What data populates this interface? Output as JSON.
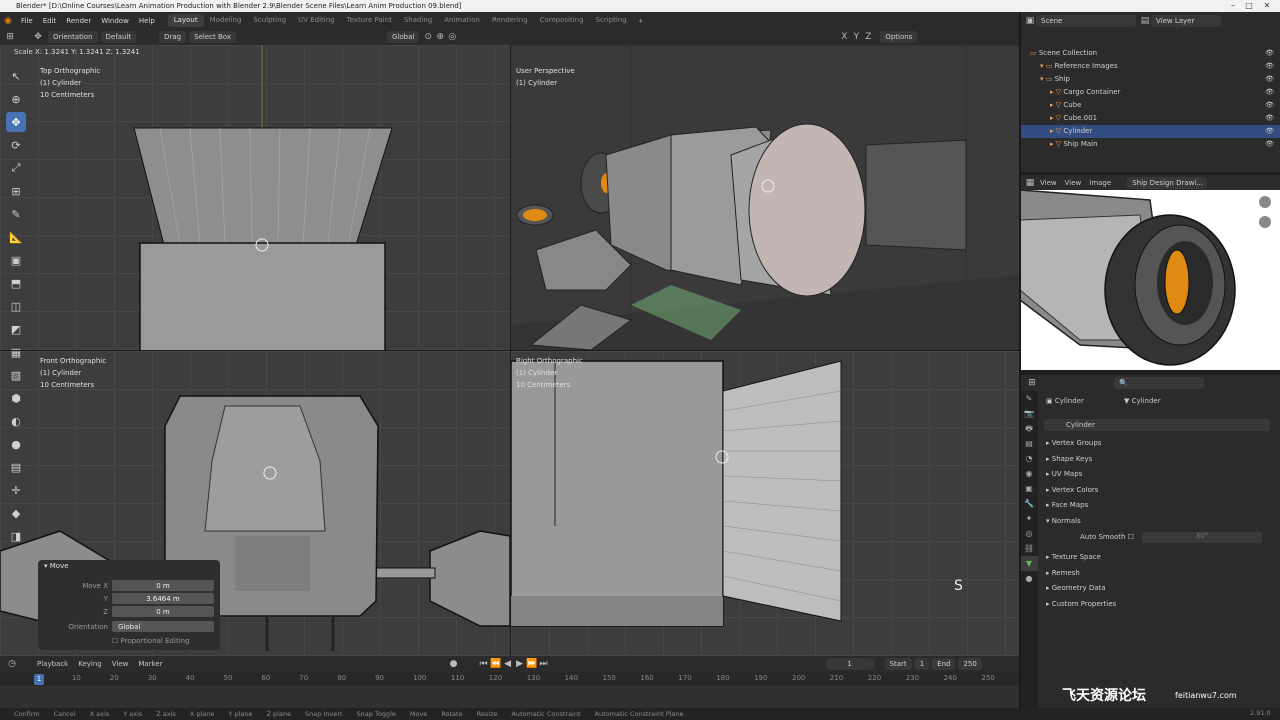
{
  "window": {
    "title": "Blender* [D:\\Online Courses\\Learn Animation Production with Blender 2.9\\Blender Scene Files\\Learn Anim Production 09.blend]"
  },
  "menus": [
    "File",
    "Edit",
    "Render",
    "Window",
    "Help"
  ],
  "workspaces": [
    "Layout",
    "Modeling",
    "Sculpting",
    "UV Editing",
    "Texture Paint",
    "Shading",
    "Animation",
    "Rendering",
    "Compositing",
    "Scripting"
  ],
  "active_workspace": "Layout",
  "scene": {
    "label": "Scene",
    "view_layer": "View Layer"
  },
  "header": {
    "orientation_label": "Orientation",
    "orientation_value": "Default",
    "drag_label": "Drag",
    "drag_value": "Select Box",
    "transform_orientation": "Global",
    "options": "Options",
    "axes": [
      "X",
      "Y",
      "Z"
    ]
  },
  "scale_info": "Scale X: 1.3241   Y: 1.3241   Z: 1.3241",
  "viewports": {
    "top": {
      "name": "Top Orthographic",
      "object": "(1) Cylinder",
      "units": "10 Centimeters"
    },
    "persp": {
      "name": "User Perspective",
      "object": "(1) Cylinder"
    },
    "front": {
      "name": "Front Orthographic",
      "object": "(1) Cylinder",
      "units": "10 Centimeters"
    },
    "right": {
      "name": "Right Orthographic",
      "object": "(1) Cylinder",
      "units": "10 Centimeters"
    }
  },
  "key_overlay": "S",
  "redo_panel": {
    "title": "Move",
    "move_x_label": "Move X",
    "move_x": "0 m",
    "y_label": "Y",
    "move_y": "3.6464 m",
    "z_label": "Z",
    "move_z": "0 m",
    "orientation_label": "Orientation",
    "orientation_value": "Global",
    "proportional": "Proportional Editing"
  },
  "timeline": {
    "menus": [
      "Playback",
      "Keying",
      "View",
      "Marker"
    ],
    "current_frame": "1",
    "start_label": "Start",
    "start": "1",
    "end_label": "End",
    "end": "250",
    "ticks": [
      "1",
      "10",
      "20",
      "30",
      "40",
      "50",
      "60",
      "70",
      "80",
      "90",
      "100",
      "110",
      "120",
      "130",
      "140",
      "150",
      "160",
      "170",
      "180",
      "190",
      "200",
      "210",
      "220",
      "230",
      "240",
      "250"
    ]
  },
  "statusbar": [
    "Confirm",
    "Cancel",
    "X axis",
    "Y axis",
    "Z axis",
    "X plane",
    "Y plane",
    "Z plane",
    "Snap Invert",
    "Snap Toggle",
    "Move",
    "Rotate",
    "Resize",
    "Automatic Constraint",
    "Automatic Constraint Plane"
  ],
  "version": "2.91.0",
  "outliner": {
    "rows": [
      {
        "label": "Scene Collection",
        "indent": 0,
        "selected": false
      },
      {
        "label": "Reference Images",
        "indent": 1,
        "selected": false
      },
      {
        "label": "Ship",
        "indent": 1,
        "selected": false
      },
      {
        "label": "Cargo Container",
        "indent": 2,
        "selected": false
      },
      {
        "label": "Cube",
        "indent": 2,
        "selected": false
      },
      {
        "label": "Cube.001",
        "indent": 2,
        "selected": false
      },
      {
        "label": "Cylinder",
        "indent": 2,
        "selected": true
      },
      {
        "label": "Ship Main",
        "indent": 2,
        "selected": false
      }
    ]
  },
  "image_editor": {
    "menus": [
      "View",
      "View",
      "Image"
    ],
    "image_name": "Ship Design Drawi..."
  },
  "properties": {
    "object_name": "Cylinder",
    "data_name": "Cylinder",
    "mesh_name": "Cylinder",
    "sections": [
      "Vertex Groups",
      "Shape Keys",
      "UV Maps",
      "Vertex Colors",
      "Face Maps",
      "Normals"
    ],
    "auto_smooth": "Auto Smooth",
    "auto_smooth_value": "30°",
    "sections2": [
      "Texture Space",
      "Remesh",
      "Geometry Data",
      "Custom Properties"
    ]
  },
  "watermark": {
    "text": "飞天资源论坛",
    "site": "feitianwu7.com"
  }
}
